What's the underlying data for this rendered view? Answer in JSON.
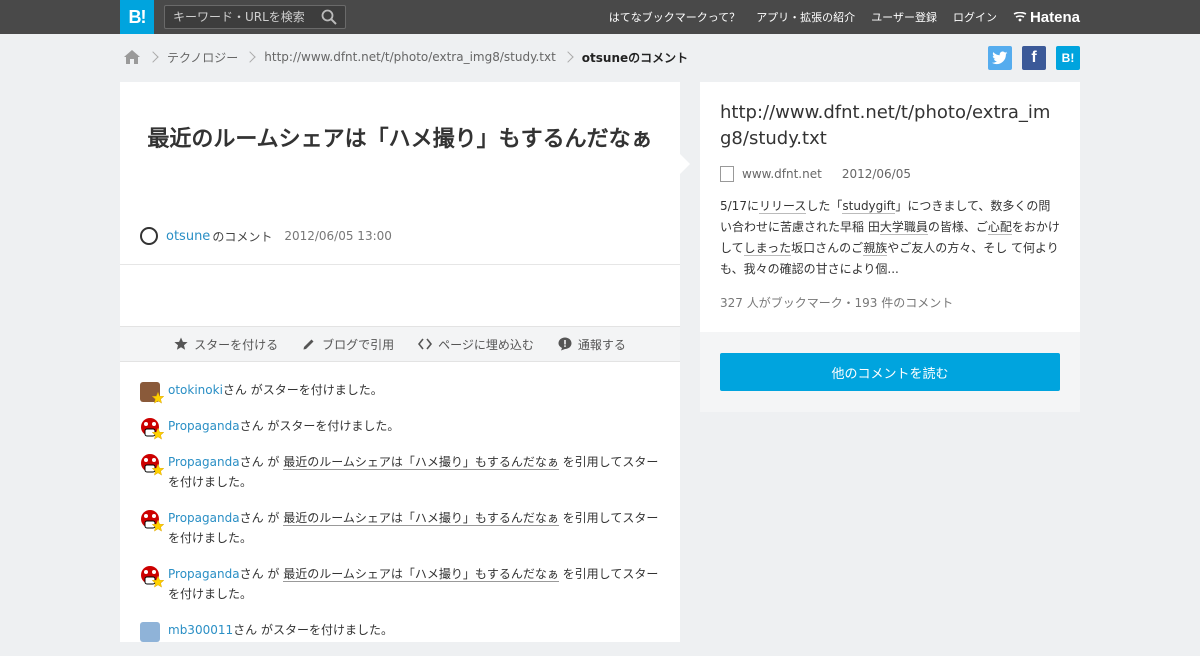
{
  "header": {
    "logo": "B!",
    "search_placeholder": "キーワード・URLを検索",
    "nav": [
      "はてなブックマークって？",
      "アプリ・拡張の紹介",
      "ユーザー登録",
      "ログイン"
    ],
    "brand": "Hatena"
  },
  "breadcrumb": {
    "category": "テクノロジー",
    "url": "http://www.dfnt.net/t/photo/extra_img8/study.txt",
    "current": "otsuneのコメント"
  },
  "share": {
    "hatena_label": "B!",
    "facebook_label": "f"
  },
  "comment": {
    "title": "最近のルームシェアは「ハメ撮り」もするんだなぁ",
    "user": "otsune",
    "user_suffix": "のコメント",
    "date": "2012/06/05 13:00"
  },
  "actions": [
    {
      "label": "スターを付ける",
      "icon": "star-icon"
    },
    {
      "label": "ブログで引用",
      "icon": "pencil-icon"
    },
    {
      "label": "ページに埋め込む",
      "icon": "code-icon"
    },
    {
      "label": "通報する",
      "icon": "report-icon"
    }
  ],
  "star_activity": [
    {
      "user": "otokinoki",
      "text": "さん がスターを付けました。",
      "quote": "",
      "after": ""
    },
    {
      "user": "Propaganda",
      "text": "さん がスターを付けました。",
      "quote": "",
      "after": ""
    },
    {
      "user": "Propaganda",
      "text": "さん が ",
      "quote": "最近のルームシェアは「ハメ撮り」もするんだなぁ",
      "after": " を引用してスターを付けました。"
    },
    {
      "user": "Propaganda",
      "text": "さん が ",
      "quote": "最近のルームシェアは「ハメ撮り」もするんだなぁ",
      "after": " を引用してスターを付けました。"
    },
    {
      "user": "Propaganda",
      "text": "さん が ",
      "quote": "最近のルームシェアは「ハメ撮り」もするんだなぁ",
      "after": " を引用してスターを付けました。"
    },
    {
      "user": "mb300011",
      "text": "さん がスターを付けました。",
      "quote": "",
      "after": ""
    }
  ],
  "entry": {
    "url": "http://www.dfnt.net/t/photo/extra_img8/study.txt",
    "domain": "www.dfnt.net",
    "date": "2012/06/05",
    "description_parts": [
      {
        "text": "5/17に",
        "u": false
      },
      {
        "text": "リリース",
        "u": true
      },
      {
        "text": "した「",
        "u": false
      },
      {
        "text": "studygift",
        "u": true
      },
      {
        "text": "」につきまして、数多くの問い合わせに苦慮された早稲 田",
        "u": false
      },
      {
        "text": "大学職員",
        "u": true
      },
      {
        "text": "の皆様、ご",
        "u": false
      },
      {
        "text": "心配",
        "u": true
      },
      {
        "text": "をおかけして",
        "u": false
      },
      {
        "text": "しまった",
        "u": true
      },
      {
        "text": "坂口さんのご",
        "u": false
      },
      {
        "text": "親族",
        "u": true
      },
      {
        "text": "やご友人の方々、そし て何よりも、我々の確認の甘さにより個...",
        "u": false
      }
    ],
    "counts": "327 人がブックマーク・193 件のコメント",
    "read_more": "他のコメントを読む"
  }
}
